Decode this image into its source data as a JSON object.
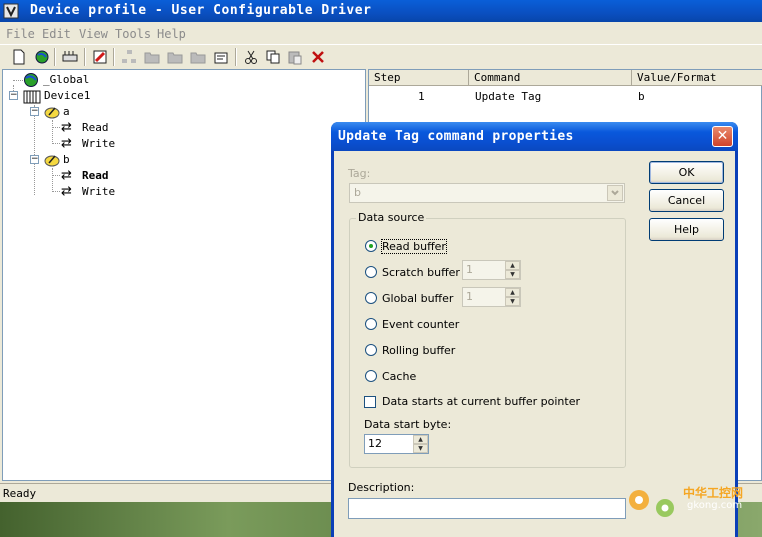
{
  "main_window": {
    "title": "Device profile - User Configurable Driver",
    "menu": [
      "File",
      "Edit",
      "View",
      "Tools",
      "Help"
    ],
    "status": "Ready"
  },
  "tree": {
    "items": [
      {
        "label": "_Global"
      },
      {
        "label": "Device1"
      },
      {
        "label": "a"
      },
      {
        "label": "Read"
      },
      {
        "label": "Write"
      },
      {
        "label": "b"
      },
      {
        "label": "Read"
      },
      {
        "label": "Write"
      }
    ]
  },
  "grid": {
    "columns": [
      "Step",
      "Command",
      "Value/Format"
    ],
    "rows": [
      {
        "step": "1",
        "command": "Update Tag",
        "value": "b"
      }
    ]
  },
  "dialog": {
    "title": "Update Tag command properties",
    "tag_label": "Tag:",
    "tag_value": "b",
    "data_source_label": "Data source",
    "options": [
      "Read buffer",
      "Scratch buffer",
      "Global buffer",
      "Event counter",
      "Rolling buffer",
      "Cache"
    ],
    "selected_option": "Read buffer",
    "scratch_value": "1",
    "global_value": "1",
    "checkbox_label": "Data starts at current buffer pointer",
    "checkbox_checked": false,
    "start_byte_label": "Data start byte:",
    "start_byte_value": "12",
    "description_label": "Description:",
    "description_value": "",
    "buttons": {
      "ok": "OK",
      "cancel": "Cancel",
      "help": "Help"
    }
  },
  "watermark": {
    "cn": "中华工控网",
    "url": "gkong.com"
  }
}
